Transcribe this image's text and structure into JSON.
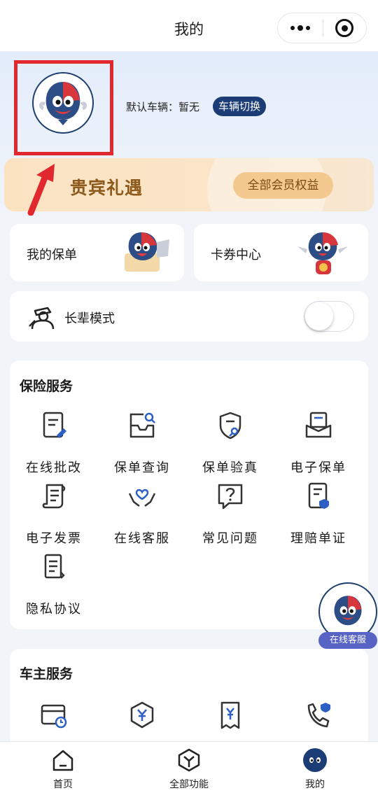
{
  "header": {
    "title": "我的"
  },
  "profile": {
    "vehicle_label": "默认车辆：暂无",
    "switch_vehicle_label": "车辆切换"
  },
  "vip": {
    "title": "贵宾礼遇",
    "button_label": "全部会员权益"
  },
  "quick": {
    "policy_label": "我的保单",
    "coupon_label": "卡券中心"
  },
  "elder_mode": {
    "label": "长辈模式",
    "enabled": false
  },
  "insurance_services": {
    "title": "保险服务",
    "items": [
      {
        "label": "在线批改",
        "icon": "edit-document-icon"
      },
      {
        "label": "保单查询",
        "icon": "search-inbox-icon"
      },
      {
        "label": "保单验真",
        "icon": "shield-verify-icon"
      },
      {
        "label": "电子保单",
        "icon": "e-policy-icon"
      },
      {
        "label": "电子发票",
        "icon": "scroll-invoice-icon"
      },
      {
        "label": "在线客服",
        "icon": "hands-heart-icon"
      },
      {
        "label": "常见问题",
        "icon": "question-bubble-icon"
      },
      {
        "label": "理赔单证",
        "icon": "claim-document-icon"
      },
      {
        "label": "隐私协议",
        "icon": "privacy-scroll-icon"
      }
    ]
  },
  "owner_services": {
    "title": "车主服务",
    "items": [
      {
        "icon": "card-clock-icon"
      },
      {
        "icon": "hexagon-yen-icon"
      },
      {
        "icon": "bill-yen-icon"
      },
      {
        "icon": "phone-shield-icon"
      }
    ]
  },
  "floating": {
    "service_label": "在线客服"
  },
  "tabbar": {
    "items": [
      {
        "label": "首页",
        "icon": "home-icon"
      },
      {
        "label": "全部功能",
        "icon": "all-functions-icon"
      },
      {
        "label": "我的",
        "icon": "mascot-profile-icon",
        "active": true
      }
    ]
  },
  "colors": {
    "brand_navy": "#1b3c74",
    "highlight_red": "#e0282e",
    "vip_gold": "#8e5a1b"
  }
}
